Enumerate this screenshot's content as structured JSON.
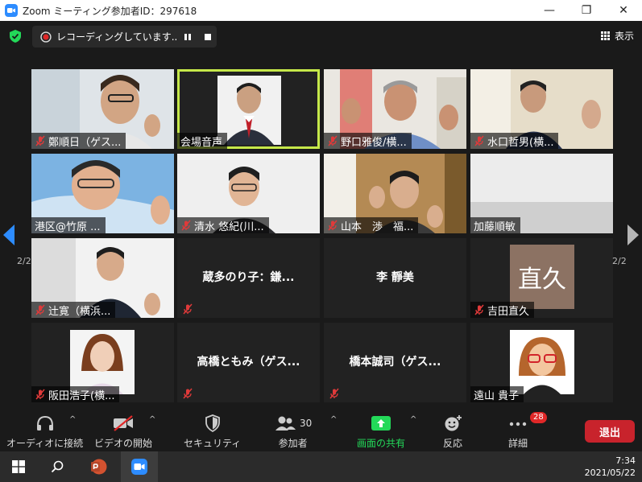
{
  "window": {
    "title": "Zoom ミーティング参加者ID：297618",
    "minimize": "—",
    "maximize": "❐",
    "close": "✕"
  },
  "header": {
    "recording_text": "レコーディングしています...",
    "view_label": "表示"
  },
  "participants": [
    {
      "name": "鄭順日（ゲス...",
      "muted": true,
      "mode": "video"
    },
    {
      "name": "会場音声",
      "muted": false,
      "mode": "video",
      "speaking": true
    },
    {
      "name": "野口雅俊/横...",
      "muted": true,
      "mode": "video"
    },
    {
      "name": "水口哲男(横...",
      "muted": true,
      "mode": "video"
    },
    {
      "name": "港区@竹原 ...",
      "muted": false,
      "mode": "video"
    },
    {
      "name": "清水 悠紀(川...",
      "muted": true,
      "mode": "video"
    },
    {
      "name": "山本　渉　福...",
      "muted": true,
      "mode": "video"
    },
    {
      "name": "加藤順敏",
      "muted": false,
      "mode": "video"
    },
    {
      "name": "辻寛（横浜...",
      "muted": true,
      "mode": "video"
    },
    {
      "name": "蔵多のり子：鎌...",
      "muted": true,
      "mode": "name"
    },
    {
      "name": "李 靜美",
      "muted": false,
      "mode": "name"
    },
    {
      "name": "吉田直久",
      "muted": true,
      "mode": "avatar",
      "avatar_text": "直久"
    },
    {
      "name": "阪田浩子(横...",
      "muted": true,
      "mode": "photo"
    },
    {
      "name": "高橋ともみ（ゲス...",
      "muted": true,
      "mode": "name"
    },
    {
      "name": "橋本誠司（ゲス...",
      "muted": true,
      "mode": "name"
    },
    {
      "name": "遠山 貴子",
      "muted": false,
      "mode": "photo"
    }
  ],
  "pagination": {
    "left": "2/2",
    "right": "2/2"
  },
  "toolbar": {
    "audio_label": "オーディオに接続",
    "video_label": "ビデオの開始",
    "security_label": "セキュリティ",
    "participants_label": "参加者",
    "participants_count": "30",
    "share_label": "画面の共有",
    "reactions_label": "反応",
    "more_label": "詳細",
    "more_badge": "28",
    "leave_label": "退出"
  },
  "taskbar": {
    "time": "7:34",
    "date": "2021/05/22"
  },
  "colors": {
    "accent_green": "#23d959",
    "speaking_border": "#c6e84a",
    "leave_red": "#c8232c",
    "arrow_blue": "#2d8cff"
  }
}
